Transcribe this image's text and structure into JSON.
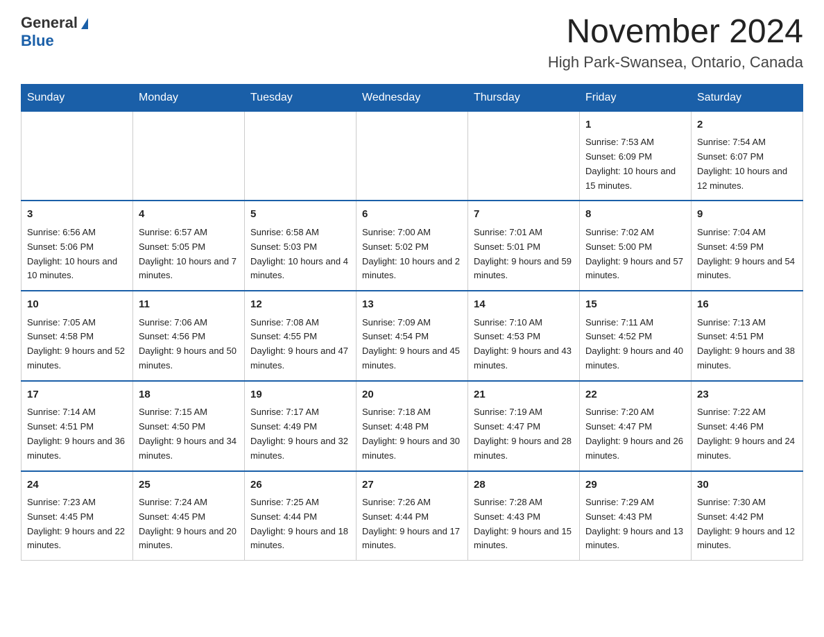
{
  "header": {
    "logo_text": "General",
    "logo_blue": "Blue",
    "month_title": "November 2024",
    "location": "High Park-Swansea, Ontario, Canada"
  },
  "days_of_week": [
    "Sunday",
    "Monday",
    "Tuesday",
    "Wednesday",
    "Thursday",
    "Friday",
    "Saturday"
  ],
  "weeks": [
    [
      {
        "day": "",
        "sunrise": "",
        "sunset": "",
        "daylight": ""
      },
      {
        "day": "",
        "sunrise": "",
        "sunset": "",
        "daylight": ""
      },
      {
        "day": "",
        "sunrise": "",
        "sunset": "",
        "daylight": ""
      },
      {
        "day": "",
        "sunrise": "",
        "sunset": "",
        "daylight": ""
      },
      {
        "day": "",
        "sunrise": "",
        "sunset": "",
        "daylight": ""
      },
      {
        "day": "1",
        "sunrise": "Sunrise: 7:53 AM",
        "sunset": "Sunset: 6:09 PM",
        "daylight": "Daylight: 10 hours and 15 minutes."
      },
      {
        "day": "2",
        "sunrise": "Sunrise: 7:54 AM",
        "sunset": "Sunset: 6:07 PM",
        "daylight": "Daylight: 10 hours and 12 minutes."
      }
    ],
    [
      {
        "day": "3",
        "sunrise": "Sunrise: 6:56 AM",
        "sunset": "Sunset: 5:06 PM",
        "daylight": "Daylight: 10 hours and 10 minutes."
      },
      {
        "day": "4",
        "sunrise": "Sunrise: 6:57 AM",
        "sunset": "Sunset: 5:05 PM",
        "daylight": "Daylight: 10 hours and 7 minutes."
      },
      {
        "day": "5",
        "sunrise": "Sunrise: 6:58 AM",
        "sunset": "Sunset: 5:03 PM",
        "daylight": "Daylight: 10 hours and 4 minutes."
      },
      {
        "day": "6",
        "sunrise": "Sunrise: 7:00 AM",
        "sunset": "Sunset: 5:02 PM",
        "daylight": "Daylight: 10 hours and 2 minutes."
      },
      {
        "day": "7",
        "sunrise": "Sunrise: 7:01 AM",
        "sunset": "Sunset: 5:01 PM",
        "daylight": "Daylight: 9 hours and 59 minutes."
      },
      {
        "day": "8",
        "sunrise": "Sunrise: 7:02 AM",
        "sunset": "Sunset: 5:00 PM",
        "daylight": "Daylight: 9 hours and 57 minutes."
      },
      {
        "day": "9",
        "sunrise": "Sunrise: 7:04 AM",
        "sunset": "Sunset: 4:59 PM",
        "daylight": "Daylight: 9 hours and 54 minutes."
      }
    ],
    [
      {
        "day": "10",
        "sunrise": "Sunrise: 7:05 AM",
        "sunset": "Sunset: 4:58 PM",
        "daylight": "Daylight: 9 hours and 52 minutes."
      },
      {
        "day": "11",
        "sunrise": "Sunrise: 7:06 AM",
        "sunset": "Sunset: 4:56 PM",
        "daylight": "Daylight: 9 hours and 50 minutes."
      },
      {
        "day": "12",
        "sunrise": "Sunrise: 7:08 AM",
        "sunset": "Sunset: 4:55 PM",
        "daylight": "Daylight: 9 hours and 47 minutes."
      },
      {
        "day": "13",
        "sunrise": "Sunrise: 7:09 AM",
        "sunset": "Sunset: 4:54 PM",
        "daylight": "Daylight: 9 hours and 45 minutes."
      },
      {
        "day": "14",
        "sunrise": "Sunrise: 7:10 AM",
        "sunset": "Sunset: 4:53 PM",
        "daylight": "Daylight: 9 hours and 43 minutes."
      },
      {
        "day": "15",
        "sunrise": "Sunrise: 7:11 AM",
        "sunset": "Sunset: 4:52 PM",
        "daylight": "Daylight: 9 hours and 40 minutes."
      },
      {
        "day": "16",
        "sunrise": "Sunrise: 7:13 AM",
        "sunset": "Sunset: 4:51 PM",
        "daylight": "Daylight: 9 hours and 38 minutes."
      }
    ],
    [
      {
        "day": "17",
        "sunrise": "Sunrise: 7:14 AM",
        "sunset": "Sunset: 4:51 PM",
        "daylight": "Daylight: 9 hours and 36 minutes."
      },
      {
        "day": "18",
        "sunrise": "Sunrise: 7:15 AM",
        "sunset": "Sunset: 4:50 PM",
        "daylight": "Daylight: 9 hours and 34 minutes."
      },
      {
        "day": "19",
        "sunrise": "Sunrise: 7:17 AM",
        "sunset": "Sunset: 4:49 PM",
        "daylight": "Daylight: 9 hours and 32 minutes."
      },
      {
        "day": "20",
        "sunrise": "Sunrise: 7:18 AM",
        "sunset": "Sunset: 4:48 PM",
        "daylight": "Daylight: 9 hours and 30 minutes."
      },
      {
        "day": "21",
        "sunrise": "Sunrise: 7:19 AM",
        "sunset": "Sunset: 4:47 PM",
        "daylight": "Daylight: 9 hours and 28 minutes."
      },
      {
        "day": "22",
        "sunrise": "Sunrise: 7:20 AM",
        "sunset": "Sunset: 4:47 PM",
        "daylight": "Daylight: 9 hours and 26 minutes."
      },
      {
        "day": "23",
        "sunrise": "Sunrise: 7:22 AM",
        "sunset": "Sunset: 4:46 PM",
        "daylight": "Daylight: 9 hours and 24 minutes."
      }
    ],
    [
      {
        "day": "24",
        "sunrise": "Sunrise: 7:23 AM",
        "sunset": "Sunset: 4:45 PM",
        "daylight": "Daylight: 9 hours and 22 minutes."
      },
      {
        "day": "25",
        "sunrise": "Sunrise: 7:24 AM",
        "sunset": "Sunset: 4:45 PM",
        "daylight": "Daylight: 9 hours and 20 minutes."
      },
      {
        "day": "26",
        "sunrise": "Sunrise: 7:25 AM",
        "sunset": "Sunset: 4:44 PM",
        "daylight": "Daylight: 9 hours and 18 minutes."
      },
      {
        "day": "27",
        "sunrise": "Sunrise: 7:26 AM",
        "sunset": "Sunset: 4:44 PM",
        "daylight": "Daylight: 9 hours and 17 minutes."
      },
      {
        "day": "28",
        "sunrise": "Sunrise: 7:28 AM",
        "sunset": "Sunset: 4:43 PM",
        "daylight": "Daylight: 9 hours and 15 minutes."
      },
      {
        "day": "29",
        "sunrise": "Sunrise: 7:29 AM",
        "sunset": "Sunset: 4:43 PM",
        "daylight": "Daylight: 9 hours and 13 minutes."
      },
      {
        "day": "30",
        "sunrise": "Sunrise: 7:30 AM",
        "sunset": "Sunset: 4:42 PM",
        "daylight": "Daylight: 9 hours and 12 minutes."
      }
    ]
  ]
}
